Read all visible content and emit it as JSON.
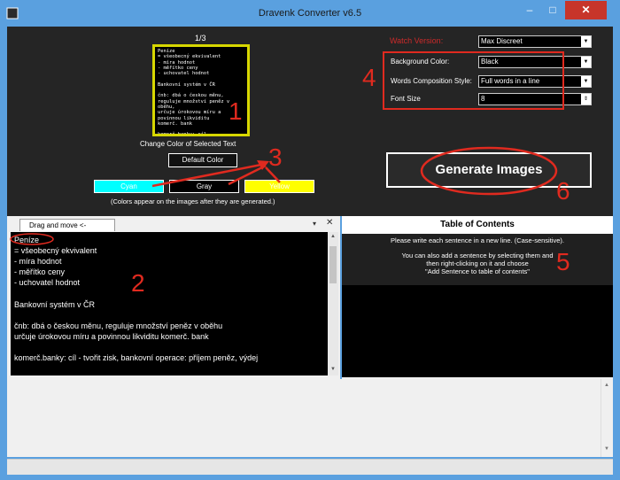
{
  "window": {
    "title": "Dravenk Converter v6.5",
    "minimize_glyph": "–",
    "maximize_glyph": "□",
    "close_glyph": "✕"
  },
  "preview": {
    "page_counter": "1/3",
    "text": "Peníze\n= všeobecný ekvivalent\n- míra hodnot\n- měřítko ceny\n- uchovatel hodnot\n\nBankovní systém v ČR\n\nčnb: dbá o českou měnu,\nreguluje množství peněz v\noběhu,\nurčuje úrokovou míru a\npovinnou likviditu\nkomerč. bank\n\nkomerč.banky: cíl -\ntvořit zisk, bankovní\noperace: příjem peněz,",
    "change_color_label": "Change Color of Selected Text",
    "default_color_button": "Default Color",
    "color_buttons": [
      "Cyan",
      "Gray",
      "Yellow"
    ],
    "colors_note": "(Colors appear on the images after they are generated.)"
  },
  "settings": {
    "watch_version_label": "Watch Version:",
    "watch_version_value": "Max Discreet",
    "background_color_label": "Background Color:",
    "background_color_value": "Black",
    "words_composition_label": "Words Composition Style:",
    "words_composition_value": "Full words in a line",
    "font_size_label": "Font Size",
    "font_size_value": "8"
  },
  "generate_button": "Generate Images",
  "editor": {
    "tab_label": "Drag and move <-",
    "menu_glyph": "▾",
    "close_glyph": "✕",
    "text": "Peníze\n= všeobecný ekvivalent\n- míra hodnot\n- měřítko ceny\n- uchovatel hodnot\n\nBankovní systém v ČR\n\nčnb: dbá o českou měnu, reguluje množství peněz v oběhu\nurčuje úrokovou míru a povinnou likviditu komerč. bank\n\nkomerč.banky: cíl - tvořit zisk, bankovní operace: příjem peněz, výdej"
  },
  "toc": {
    "header": "Table of Contents",
    "line1": "Please write each sentence in a new line. (Case-sensitive).",
    "line2a": "You can also add a sentence by selecting them and",
    "line2b": "then right-clicking on it and choose",
    "line2c": "\"Add Sentence to table of contents\""
  },
  "annotations": [
    "1",
    "2",
    "3",
    "4",
    "5",
    "6"
  ],
  "colors": {
    "annotation_red": "#e02a1f",
    "title_bar_blue": "#5aa0df",
    "preview_border_yellow": "#d7d700",
    "cyan": "#00ffff",
    "yellow": "#ffff00"
  },
  "icons": [
    "app-icon",
    "minimize-icon",
    "maximize-icon",
    "close-icon",
    "dropdown-arrow-icon",
    "spin-arrows-icon",
    "scroll-up-arrow-icon",
    "scroll-down-arrow-icon"
  ]
}
